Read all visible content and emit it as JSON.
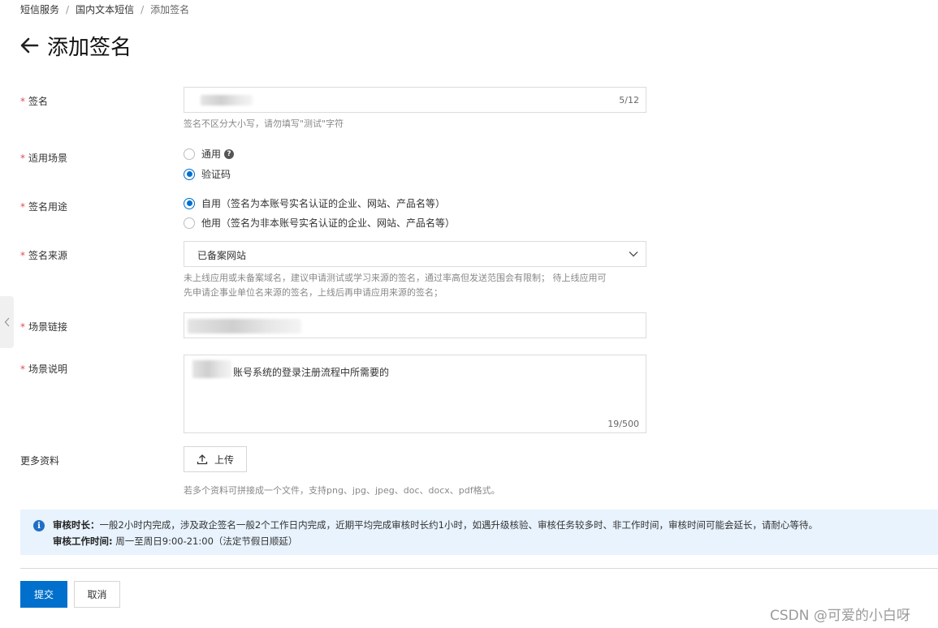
{
  "breadcrumb": {
    "items": [
      "短信服务",
      "国内文本短信",
      "添加签名"
    ],
    "separator": "/"
  },
  "page": {
    "title": "添加签名",
    "back_icon": "arrow-left-icon"
  },
  "form": {
    "required_mark": "*",
    "signature": {
      "label": "签名",
      "counter": "5/12",
      "help": "签名不区分大小写，请勿填写\"测试\"字符"
    },
    "scene": {
      "label": "适用场景",
      "options": [
        {
          "label": "通用",
          "checked": false,
          "has_help_icon": true
        },
        {
          "label": "验证码",
          "checked": true
        }
      ],
      "help_icon_glyph": "?"
    },
    "usage": {
      "label": "签名用途",
      "options": [
        {
          "label": "自用（签名为本账号实名认证的企业、网站、产品名等）",
          "checked": true
        },
        {
          "label": "他用（签名为非本账号实名认证的企业、网站、产品名等）",
          "checked": false
        }
      ]
    },
    "source": {
      "label": "签名来源",
      "selected": "已备案网站",
      "help_line1": "未上线应用或未备案域名，建议申请测试或学习来源的签名，通过率高但发送范围会有限制；  待上线应用可",
      "help_line2": "先申请企事业单位名来源的签名，上线后再申请应用来源的签名；"
    },
    "scene_link": {
      "label": "场景链接"
    },
    "scene_desc": {
      "label": "场景说明",
      "value_visible": "账号系统的登录注册流程中所需要的",
      "counter": "19/500"
    },
    "more": {
      "label": "更多资料",
      "upload_label": "上传",
      "help": "若多个资料可拼接成一个文件，支持png、jpg、jpeg、doc、docx、pdf格式。"
    }
  },
  "notice": {
    "icon_glyph": "i",
    "line1_title": "审核时长：",
    "line1_text": "一般2小时内完成，涉及政企签名一般2个工作日内完成，近期平均完成审核时长约1小时，如遇升级核验、审核任务较多时、非工作时间，审核时间可能会延长，请耐心等待。",
    "line2_title": "审核工作时间:",
    "line2_text": " 周一至周日9:00-21:00（法定节假日顺延）"
  },
  "actions": {
    "submit": "提交",
    "cancel": "取消"
  },
  "watermark": "CSDN @可爱的小白呀",
  "colors": {
    "primary": "#0070cc",
    "required": "#e24d4d",
    "notice_bg": "#e8f3fd",
    "info": "#1f6fc5"
  }
}
